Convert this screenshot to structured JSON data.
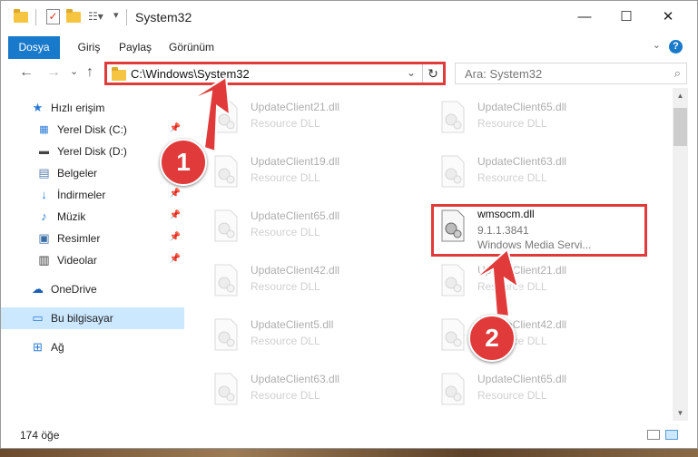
{
  "window": {
    "title": "System32",
    "buttons": {
      "minimize": "—",
      "maximize": "☐",
      "close": "✕"
    }
  },
  "ribbon": {
    "tabs": [
      "Dosya",
      "Giriş",
      "Paylaş",
      "Görünüm"
    ],
    "help": "?"
  },
  "navigation": {
    "back": "←",
    "forward": "→",
    "recent": "⌄",
    "up": "↑",
    "address": "C:\\Windows\\System32",
    "search_placeholder": "Ara: System32"
  },
  "sidebar": {
    "items": [
      {
        "label": "Hızlı erişim",
        "icon": "star-icon",
        "pinned": false
      },
      {
        "label": "Yerel Disk (C:)",
        "icon": "windows-drive-icon",
        "pinned": true
      },
      {
        "label": "Yerel Disk (D:)",
        "icon": "drive-icon",
        "pinned": true
      },
      {
        "label": "Belgeler",
        "icon": "documents-icon",
        "pinned": true
      },
      {
        "label": "İndirmeler",
        "icon": "download-icon",
        "pinned": true
      },
      {
        "label": "Müzik",
        "icon": "music-icon",
        "pinned": true
      },
      {
        "label": "Resimler",
        "icon": "pictures-icon",
        "pinned": true
      },
      {
        "label": "Videolar",
        "icon": "video-icon",
        "pinned": true
      },
      {
        "label": "OneDrive",
        "icon": "cloud-icon",
        "pinned": false
      },
      {
        "label": "Bu bilgisayar",
        "icon": "computer-icon",
        "pinned": false
      },
      {
        "label": "Ağ",
        "icon": "network-icon",
        "pinned": false
      }
    ]
  },
  "files": [
    {
      "name": "UpdateClient21.dll",
      "type": "Resource DLL"
    },
    {
      "name": "UpdateClient65.dll",
      "type": "Resource DLL"
    },
    {
      "name": "UpdateClient19.dll",
      "type": "Resource DLL"
    },
    {
      "name": "UpdateClient63.dll",
      "type": "Resource DLL"
    },
    {
      "name": "UpdateClient65.dll",
      "type": "Resource DLL"
    },
    {
      "name": "wmsocm.dll",
      "version": "9.1.1.3841",
      "description": "Windows Media Servi..."
    },
    {
      "name": "UpdateClient42.dll",
      "type": "Resource DLL"
    },
    {
      "name": "UpdateClient21.dll",
      "type": "Resource DLL"
    },
    {
      "name": "UpdateClient5.dll",
      "type": "Resource DLL"
    },
    {
      "name": "UpdateClient42.dll",
      "type": "Resource DLL"
    },
    {
      "name": "UpdateClient63.dll",
      "type": "Resource DLL"
    },
    {
      "name": "UpdateClient65.dll",
      "type": "Resource DLL"
    }
  ],
  "status": {
    "item_count": "174 öğe"
  },
  "annotations": {
    "callout_1": "1",
    "callout_2": "2",
    "accent": "#e03a3a"
  }
}
